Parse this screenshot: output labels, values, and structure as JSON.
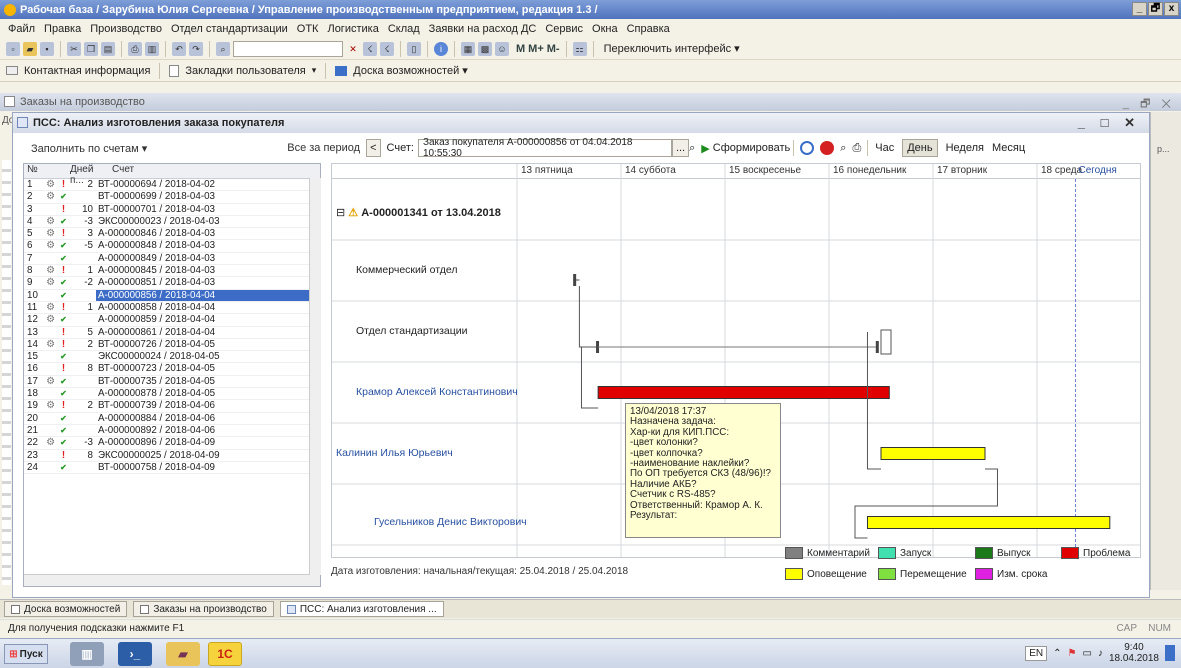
{
  "window": {
    "title": "Рабочая база / Зарубина Юлия Сергеевна / Управление производственным предприятием, редакция 1.3 /",
    "btn_min": "_",
    "btn_max": "🗗",
    "btn_close": "x"
  },
  "menu": [
    "Файл",
    "Правка",
    "Производство",
    "Отдел стандартизации",
    "ОТК",
    "Логистика",
    "Склад",
    "Заявки на расход ДС",
    "Сервис",
    "Окна",
    "Справка"
  ],
  "toolbar": {
    "m": "M",
    "mplus": "M+",
    "mminus": "M-",
    "switch": "Переключить интерфейс ▾"
  },
  "bookmarks": {
    "contact": "Контактная информация",
    "user_bm": "Закладки пользователя",
    "board": "Доска возможностей ▾"
  },
  "doc_window": {
    "title": "Заказы на производство",
    "side_label": "Дo"
  },
  "dialog": {
    "title": "ПСС: Анализ изготовления заказа покупателя",
    "fill_label": "Заполнить по счетам ▾",
    "all_period": "Все за период",
    "back": "<",
    "invoice_label": "Счет:",
    "invoice_value": "Заказ покупателя А-000000856 от 04.04.2018 10:55:30",
    "invoice_btn": "...",
    "form_btn": "Сформировать",
    "scale": [
      "Час",
      "День",
      "Неделя",
      "Месяц"
    ],
    "scale_active": "День"
  },
  "grid": {
    "col_num": "№",
    "col_days": "Дней п...",
    "col_invoice": "Счет",
    "selected_row": 10,
    "rows": [
      {
        "n": "1",
        "gear": true,
        "warn": "red",
        "check": false,
        "days": "2",
        "inv": "ВТ-00000694 / 2018-04-02"
      },
      {
        "n": "2",
        "gear": true,
        "warn": "",
        "check": true,
        "days": "",
        "inv": "ВТ-00000699 / 2018-04-03"
      },
      {
        "n": "3",
        "gear": false,
        "warn": "red",
        "check": false,
        "days": "10",
        "inv": "ВТ-00000701 / 2018-04-03"
      },
      {
        "n": "4",
        "gear": true,
        "warn": "",
        "check": true,
        "days": "-3",
        "inv": "ЭКС00000023 / 2018-04-03"
      },
      {
        "n": "5",
        "gear": true,
        "warn": "red",
        "check": false,
        "days": "3",
        "inv": "А-000000846 / 2018-04-03"
      },
      {
        "n": "6",
        "gear": true,
        "warn": "",
        "check": true,
        "days": "-5",
        "inv": "А-000000848 / 2018-04-03"
      },
      {
        "n": "7",
        "gear": false,
        "warn": "",
        "check": true,
        "days": "",
        "inv": "А-000000849 / 2018-04-03"
      },
      {
        "n": "8",
        "gear": true,
        "warn": "red",
        "check": false,
        "days": "1",
        "inv": "А-000000845 / 2018-04-03"
      },
      {
        "n": "9",
        "gear": true,
        "warn": "",
        "check": true,
        "days": "-2",
        "inv": "А-000000851 / 2018-04-03"
      },
      {
        "n": "10",
        "gear": false,
        "warn": "",
        "check": true,
        "days": "",
        "inv": "А-000000856 / 2018-04-04"
      },
      {
        "n": "11",
        "gear": true,
        "warn": "red",
        "check": false,
        "days": "1",
        "inv": "А-000000858 / 2018-04-04"
      },
      {
        "n": "12",
        "gear": true,
        "warn": "",
        "check": true,
        "days": "",
        "inv": "А-000000859 / 2018-04-04"
      },
      {
        "n": "13",
        "gear": false,
        "warn": "red",
        "check": false,
        "days": "5",
        "inv": "А-000000861 / 2018-04-04"
      },
      {
        "n": "14",
        "gear": true,
        "warn": "red",
        "check": false,
        "days": "2",
        "inv": "ВТ-00000726 / 2018-04-05"
      },
      {
        "n": "15",
        "gear": false,
        "warn": "",
        "check": true,
        "days": "",
        "inv": "ЭКС00000024 / 2018-04-05"
      },
      {
        "n": "16",
        "gear": false,
        "warn": "red",
        "check": false,
        "days": "8",
        "inv": "ВТ-00000723 / 2018-04-05"
      },
      {
        "n": "17",
        "gear": true,
        "warn": "",
        "check": true,
        "days": "",
        "inv": "ВТ-00000735 / 2018-04-05"
      },
      {
        "n": "18",
        "gear": false,
        "warn": "",
        "check": true,
        "days": "",
        "inv": "А-000000878 / 2018-04-05"
      },
      {
        "n": "19",
        "gear": true,
        "warn": "red",
        "check": false,
        "days": "2",
        "inv": "ВТ-00000739 / 2018-04-06"
      },
      {
        "n": "20",
        "gear": false,
        "warn": "",
        "check": true,
        "days": "",
        "inv": "А-000000884 / 2018-04-06"
      },
      {
        "n": "21",
        "gear": false,
        "warn": "",
        "check": true,
        "days": "",
        "inv": "А-000000892 / 2018-04-06"
      },
      {
        "n": "22",
        "gear": true,
        "warn": "",
        "check": true,
        "days": "-3",
        "inv": "А-000000896 / 2018-04-09"
      },
      {
        "n": "23",
        "gear": false,
        "warn": "red",
        "check": false,
        "days": "8",
        "inv": "ЭКС00000025 / 2018-04-09"
      },
      {
        "n": "24",
        "gear": false,
        "warn": "",
        "check": true,
        "days": "",
        "inv": "ВТ-00000758 / 2018-04-09"
      }
    ]
  },
  "timeline": {
    "days": [
      "13 пятница",
      "14 суббота",
      "15 воскресенье",
      "16 понедельник",
      "17 вторник",
      "18 среда"
    ],
    "today": "Сегодня",
    "today_at": 5.37,
    "order_title": "А-000001341 от 13.04.2018",
    "rows": [
      {
        "name": "Коммерческий отдел",
        "color": "#222",
        "bar": null
      },
      {
        "name": "Отдел стандартизации",
        "color": "#222",
        "bar": null
      },
      {
        "name": "Крамор Алексей Константинович",
        "color": "#2850a0",
        "bar": {
          "start": 0.78,
          "end": 3.58,
          "fill": "#e00000"
        }
      },
      {
        "name": "Калинин Илья Юрьевич",
        "color": "#2850a0",
        "bar": {
          "start": 3.5,
          "end": 4.5,
          "fill": "#ffff00"
        }
      },
      {
        "name": "Гусельников Денис Викторович",
        "color": "#2850a0",
        "bar": {
          "start": 3.37,
          "end": 5.7,
          "fill": "#ffff00"
        }
      }
    ],
    "date_footer": "Дата изготовления: начальная/текущая: 25.04.2018 / 25.04.2018"
  },
  "tooltip": [
    "13/04/2018 17:37",
    "Назначена задача:",
    "Хар-ки для КИП.ПСС:",
    "-цвет колонки?",
    "-цвет колпочка?",
    "-наименование наклейки?",
    "По ОП требуется СКЗ (48/96)!?",
    "Наличие АКБ?",
    "Счетчик с RS-485?",
    "Ответственный: Крамор А. К.",
    "Результат:"
  ],
  "legend": [
    {
      "label": "Комментарий",
      "color": "#808080"
    },
    {
      "label": "Запуск",
      "color": "#40e0b0"
    },
    {
      "label": "Выпуск",
      "color": "#1a7a1a"
    },
    {
      "label": "Проблема",
      "color": "#e00000"
    },
    {
      "label": "Оповещение",
      "color": "#ffff00"
    },
    {
      "label": "Перемещение",
      "color": "#80e040"
    },
    {
      "label": "Изм. срока",
      "color": "#e020e0"
    }
  ],
  "tabs": [
    "Доска возможностей",
    "Заказы на производство",
    "ПСС: Анализ изготовления ..."
  ],
  "status": {
    "hint": "Для получения подсказки нажмите F1",
    "caps": "CAP",
    "num": "NUM"
  },
  "taskbar": {
    "start": "Пуск",
    "lang": "EN",
    "time": "9:40",
    "date": "18.04.2018",
    "app_1c": "1С"
  },
  "scroll_right": "р...",
  "colors": {
    "selected": "#3d6cc6",
    "title": "#4f73bd",
    "link": "#2850a0"
  }
}
